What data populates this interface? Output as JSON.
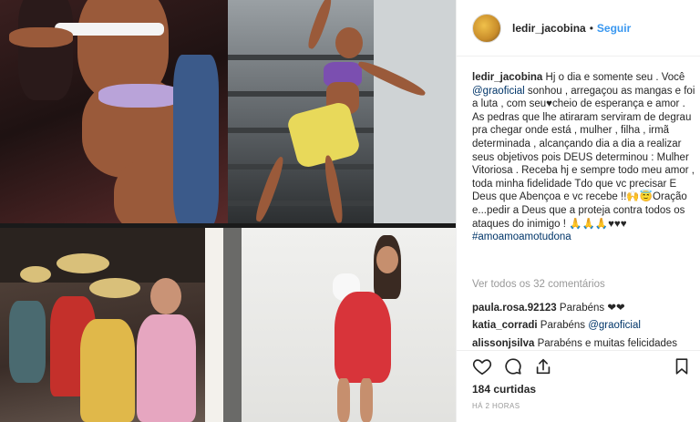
{
  "post": {
    "author": "ledir_jacobina",
    "separator": "•",
    "follow_label": "Seguir"
  },
  "caption": {
    "user": "ledir_jacobina",
    "part1": "Hj o dia e somente seu . Você ",
    "mention": "@graoficial",
    "part2": " sonhou , arregaçou as mangas e foi a luta , com seu♥cheio de esperança e amor . As pedras que lhe atiraram serviram de degrau pra chegar onde está , mulher , filha , irmã determinada , alcançando dia a dia a realizar seus objetivos pois DEUS determinou : Mulher Vitoriosa . Receba hj e sempre todo meu amor , toda minha fidelidade Tdo que vc precisar E Deus que Abençoa e vc recebe !!🙌😇Oração e...pedir a Deus que a proteja contra todos os ataques do inimigo ! 🙏🙏🙏♥♥♥",
    "hashtag": "#amoamoamotudona"
  },
  "view_all_comments": "Ver todos os 32 comentários",
  "comments": [
    {
      "user": "paula.rosa.92123",
      "text": " Parabéns ❤❤"
    },
    {
      "user": "katia_corradi",
      "text": " Parabéns ",
      "mention": "@graoficial"
    },
    {
      "user": "alissonjsilva",
      "text": " Parabéns e muitas felicidades"
    }
  ],
  "likes": "184 curtidas",
  "time": "HÁ 2 HORAS",
  "colors": {
    "link": "#3897f0",
    "mention": "#003569",
    "muted": "#999999",
    "text": "#262626"
  },
  "icons": {
    "like": "heart-icon",
    "comment": "comment-icon",
    "share": "share-icon",
    "save": "bookmark-icon"
  }
}
